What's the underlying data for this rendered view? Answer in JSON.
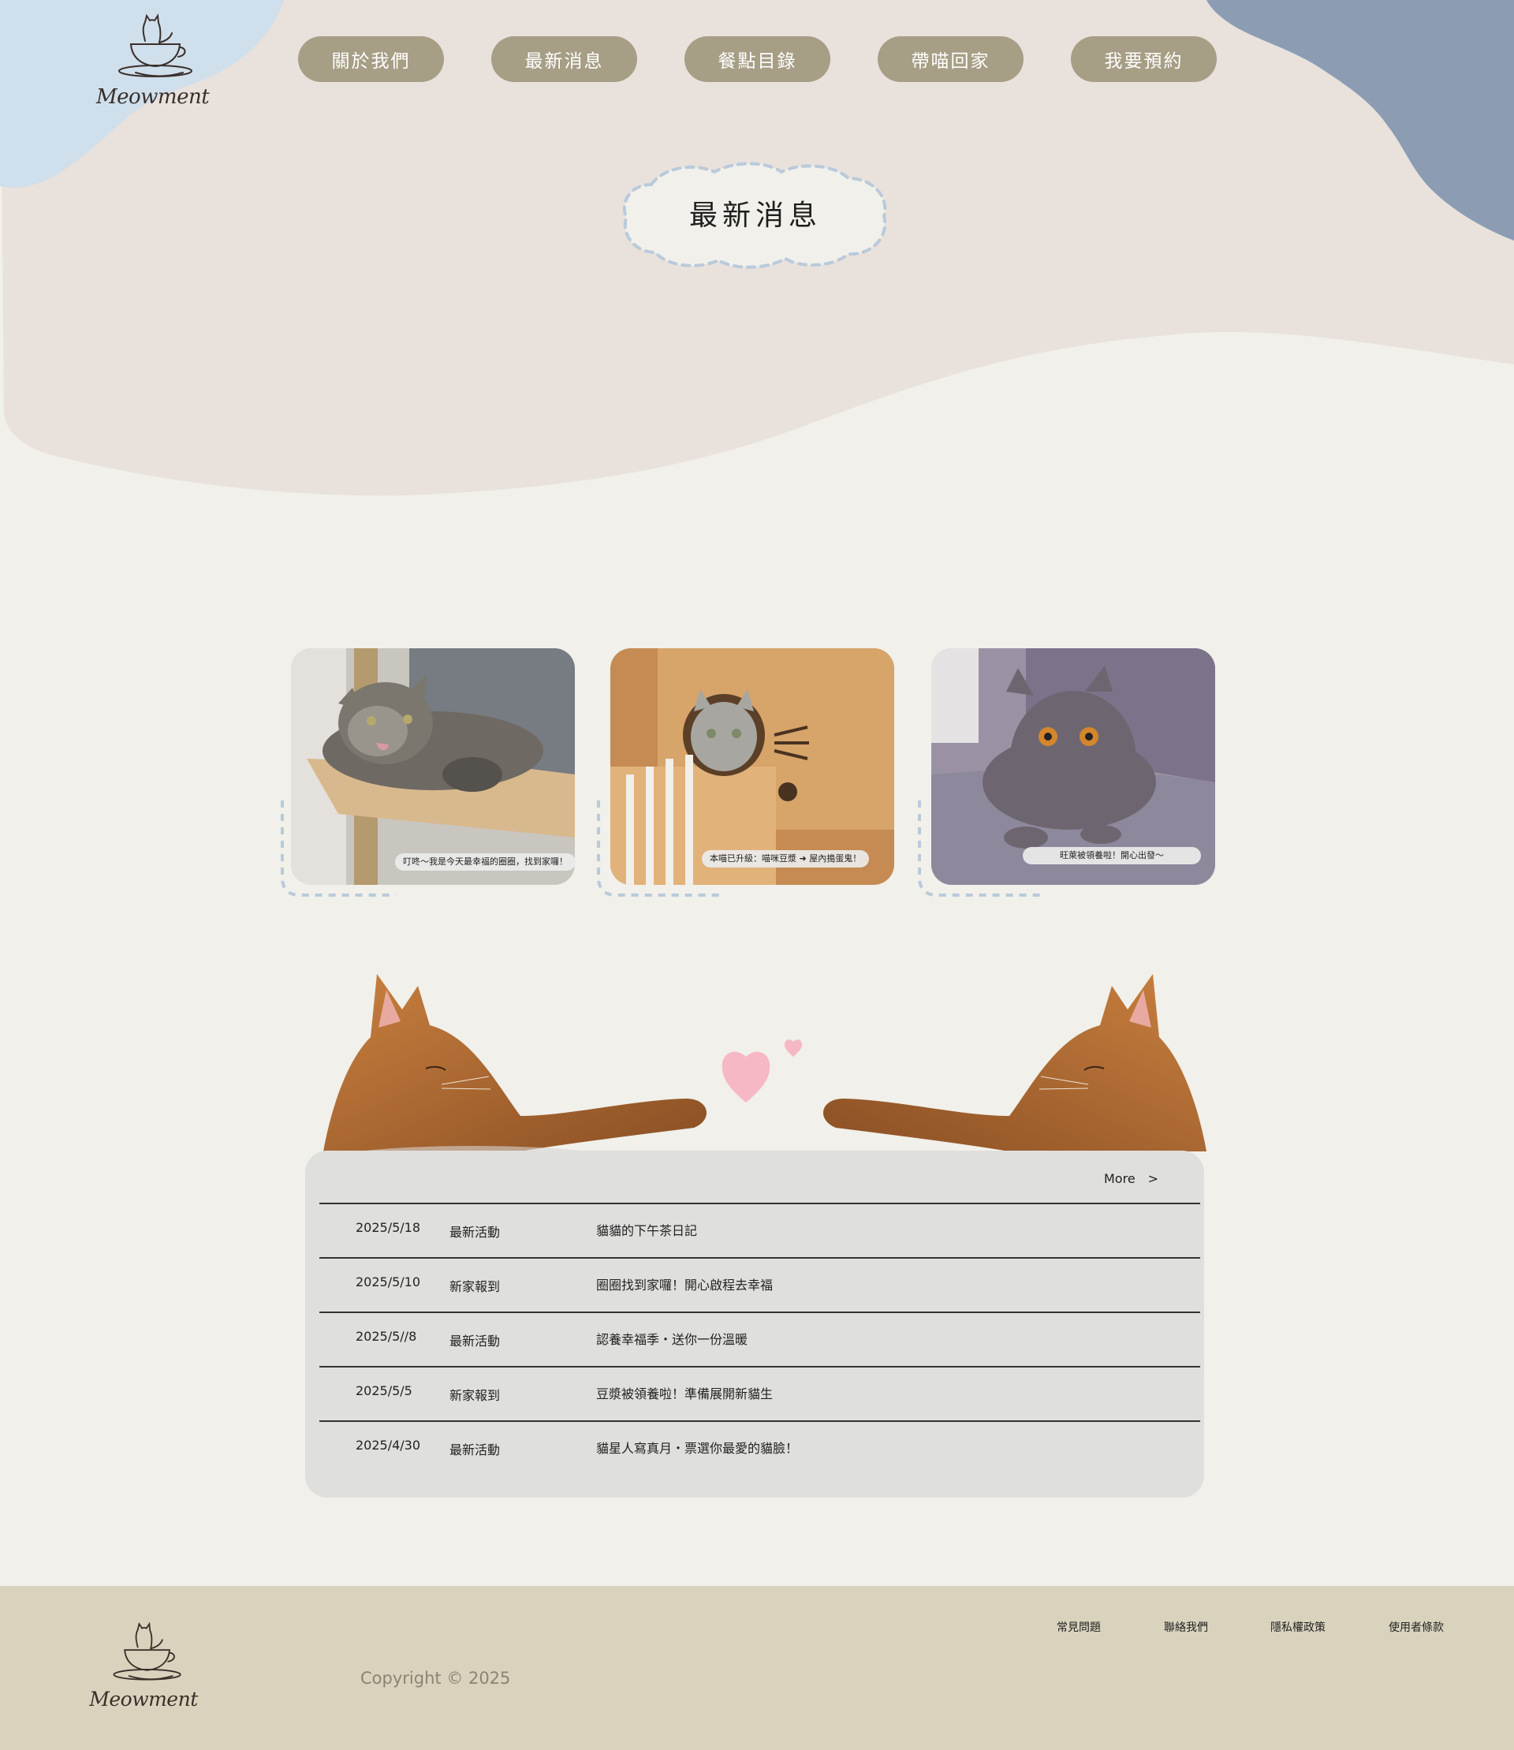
{
  "brand": {
    "name": "Meowment"
  },
  "nav": {
    "items": [
      {
        "label": "關於我們"
      },
      {
        "label": "最新消息"
      },
      {
        "label": "餐點目錄"
      },
      {
        "label": "帶喵回家"
      },
      {
        "label": "我要預約"
      }
    ]
  },
  "page_title": "最新消息",
  "cards": [
    {
      "caption": "叮咚～我是今天最幸福的圈圈，找到家囉！"
    },
    {
      "caption": "本喵已升級：喵咪豆漿 ➜ 屋內搗蛋鬼！"
    },
    {
      "caption": "旺萊被領養啦！開心出發～"
    }
  ],
  "news": {
    "more_label": "More　>",
    "rows": [
      {
        "date": "2025/5/18",
        "category": "最新活動",
        "title": "貓貓的下午茶日記"
      },
      {
        "date": "2025/5/10",
        "category": "新家報到",
        "title": "圈圈找到家囉！開心啟程去幸福"
      },
      {
        "date": "2025/5//8",
        "category": "最新活動",
        "title": "認養幸福季・送你一份溫暖"
      },
      {
        "date": "2025/5/5",
        "category": "新家報到",
        "title": "豆漿被領養啦！準備展開新貓生"
      },
      {
        "date": "2025/4/30",
        "category": "最新活動",
        "title": "貓星人寫真月・票選你最愛的貓臉！"
      }
    ]
  },
  "footer": {
    "links": [
      {
        "label": "常見問題"
      },
      {
        "label": "聯絡我們"
      },
      {
        "label": "隱私權政策"
      },
      {
        "label": "使用者條款"
      }
    ],
    "copyright": "Copyright © 2025"
  },
  "colors": {
    "page_bg": "#f1f0ea",
    "hero_blob": "#e9e1dc",
    "blue_blob": "#cfdfec",
    "slate_blob": "#8b9cb3",
    "nav_button": "#a69e85",
    "news_panel": "#dfdfdd",
    "footer_bg": "#d9d3bd",
    "dashed_accent": "#b9cadb",
    "heart": "#f6b8c4"
  },
  "icons": [
    "cat-in-cup-logo-icon",
    "heart-icon"
  ]
}
